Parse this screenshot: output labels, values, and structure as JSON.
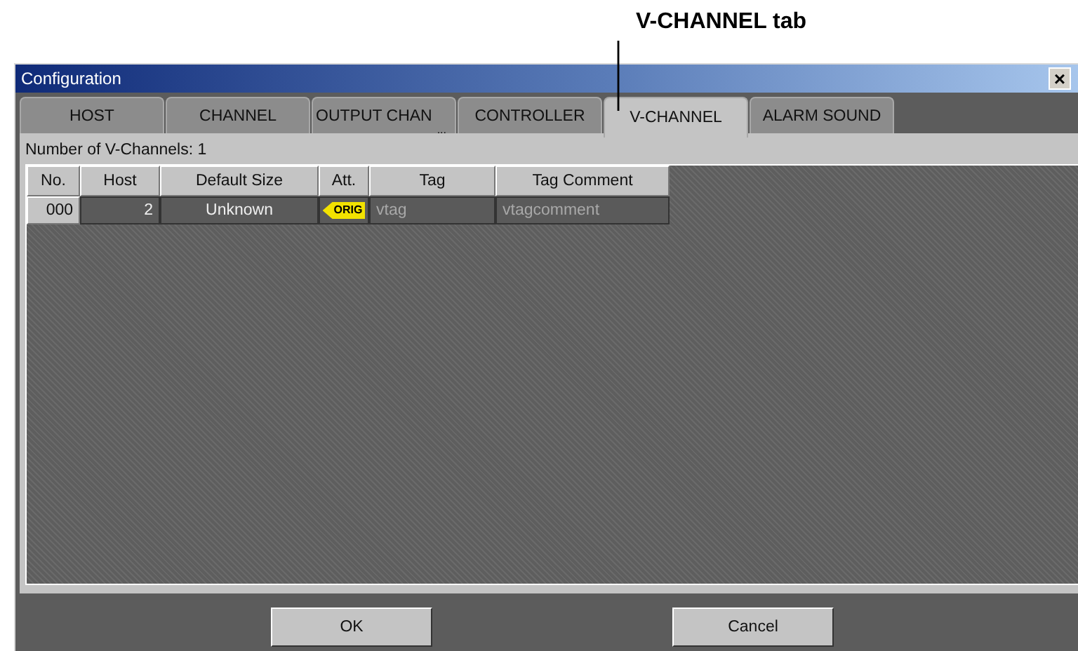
{
  "callout": {
    "text": "V-CHANNEL tab"
  },
  "window": {
    "title": "Configuration",
    "close": "×"
  },
  "tabs": [
    {
      "label": "HOST",
      "selected": false
    },
    {
      "label": "CHANNEL",
      "selected": false
    },
    {
      "label": "OUTPUT CHAN",
      "truncation_mark": "...",
      "selected": false
    },
    {
      "label": "CONTROLLER",
      "selected": false
    },
    {
      "label": "V-CHANNEL",
      "selected": true
    },
    {
      "label": "ALARM SOUND",
      "selected": false
    }
  ],
  "summary": "Number of V-Channels: 1",
  "table": {
    "columns": [
      "No.",
      "Host",
      "Default Size",
      "Att.",
      "Tag",
      "Tag Comment"
    ],
    "rows": [
      {
        "no": "000",
        "host": "2",
        "default_size": "Unknown",
        "attribute": "ORIG",
        "tag": "vtag",
        "tag_comment": "vtagcomment"
      }
    ]
  },
  "buttons": [
    "OK",
    "Cancel"
  ]
}
